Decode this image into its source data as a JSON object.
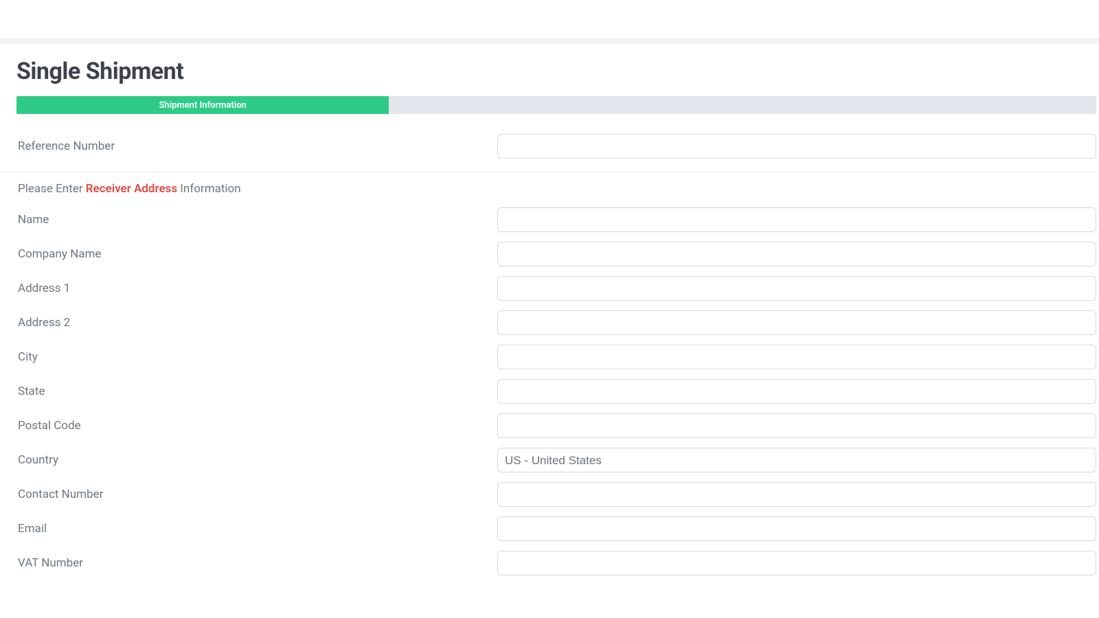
{
  "page": {
    "title": "Single Shipment"
  },
  "tabs": {
    "active_label": "Shipment Information"
  },
  "fields": {
    "reference_number": {
      "label": "Reference Number",
      "value": ""
    },
    "name": {
      "label": "Name",
      "value": ""
    },
    "company_name": {
      "label": "Company Name",
      "value": ""
    },
    "address1": {
      "label": "Address 1",
      "value": ""
    },
    "address2": {
      "label": "Address 2",
      "value": ""
    },
    "city": {
      "label": "City",
      "value": ""
    },
    "state": {
      "label": "State",
      "value": ""
    },
    "postal_code": {
      "label": "Postal Code",
      "value": ""
    },
    "country": {
      "label": "Country",
      "value": "US - United States"
    },
    "contact_number": {
      "label": "Contact Number",
      "value": ""
    },
    "email": {
      "label": "Email",
      "value": ""
    },
    "vat_number": {
      "label": "VAT Number",
      "value": ""
    }
  },
  "section_prompt": {
    "prefix": "Please Enter ",
    "highlight": "Receiver Address",
    "suffix": " Information"
  }
}
